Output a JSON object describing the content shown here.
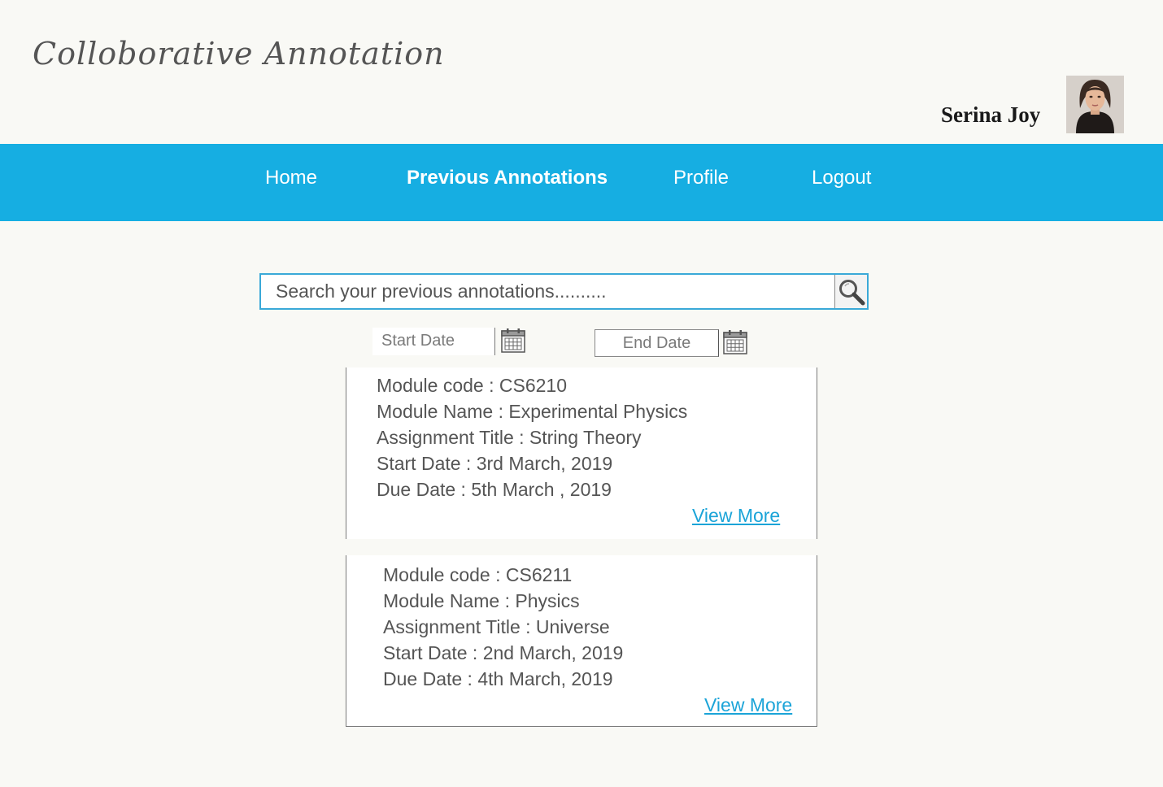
{
  "header": {
    "app_title": "Colloborative Annotation",
    "user_name": "Serina Joy"
  },
  "nav": {
    "items": [
      {
        "label": "Home",
        "active": false
      },
      {
        "label": "Previous Annotations",
        "active": true
      },
      {
        "label": "Profile",
        "active": false
      },
      {
        "label": "Logout",
        "active": false
      }
    ]
  },
  "search": {
    "placeholder": "Search your previous annotations..........",
    "value": ""
  },
  "date_filter": {
    "start_label": "Start Date",
    "end_label": "End Date"
  },
  "annotations": [
    {
      "module_code": "Module code : CS6210",
      "module_name": "Module Name : Experimental Physics",
      "assignment_title": "Assignment Title : String Theory",
      "start_date": "Start Date : 3rd March, 2019",
      "due_date": "Due Date : 5th March , 2019",
      "view_more": "View More"
    },
    {
      "module_code": "Module code : CS6211",
      "module_name": "Module Name : Physics",
      "assignment_title": "Assignment Title : Universe",
      "start_date": "Start Date : 2nd March, 2019",
      "due_date": "Due Date : 4th March, 2019",
      "view_more": "View More"
    }
  ],
  "colors": {
    "nav_background": "#16aee2",
    "link": "#1ba4d8",
    "page_background": "#f9f9f5",
    "search_border": "#3aa9d8"
  },
  "icons": [
    "search-icon",
    "calendar-icon",
    "avatar"
  ]
}
